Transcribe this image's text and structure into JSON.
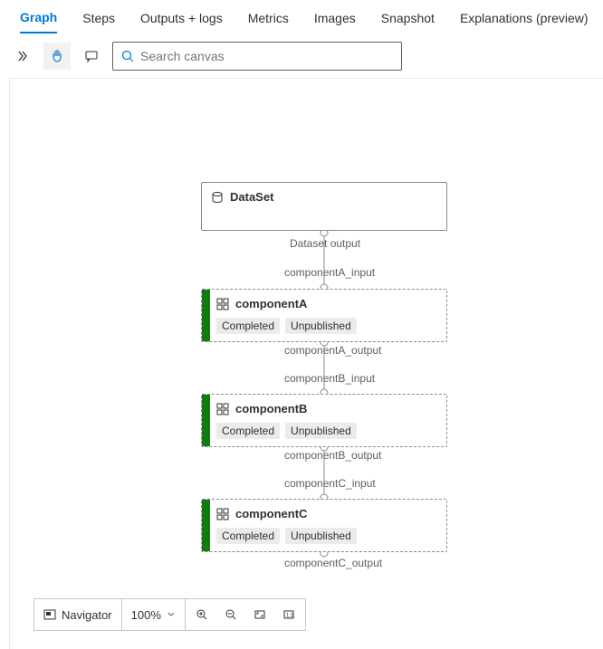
{
  "tabs": [
    {
      "label": "Graph",
      "active": true
    },
    {
      "label": "Steps"
    },
    {
      "label": "Outputs + logs"
    },
    {
      "label": "Metrics"
    },
    {
      "label": "Images"
    },
    {
      "label": "Snapshot"
    },
    {
      "label": "Explanations (preview)"
    }
  ],
  "search": {
    "placeholder": "Search canvas"
  },
  "nodes": {
    "dataset": {
      "title": "DataSet",
      "output_label": "Dataset output"
    },
    "compA": {
      "title": "componentA",
      "status": "Completed",
      "publish": "Unpublished",
      "input_label": "componentA_input",
      "output_label": "componentA_output"
    },
    "compB": {
      "title": "componentB",
      "status": "Completed",
      "publish": "Unpublished",
      "input_label": "componentB_input",
      "output_label": "componentB_output"
    },
    "compC": {
      "title": "componentC",
      "status": "Completed",
      "publish": "Unpublished",
      "input_label": "componentC_input",
      "output_label": "componentC_output"
    }
  },
  "navigator": {
    "label": "Navigator",
    "zoom": "100%"
  }
}
